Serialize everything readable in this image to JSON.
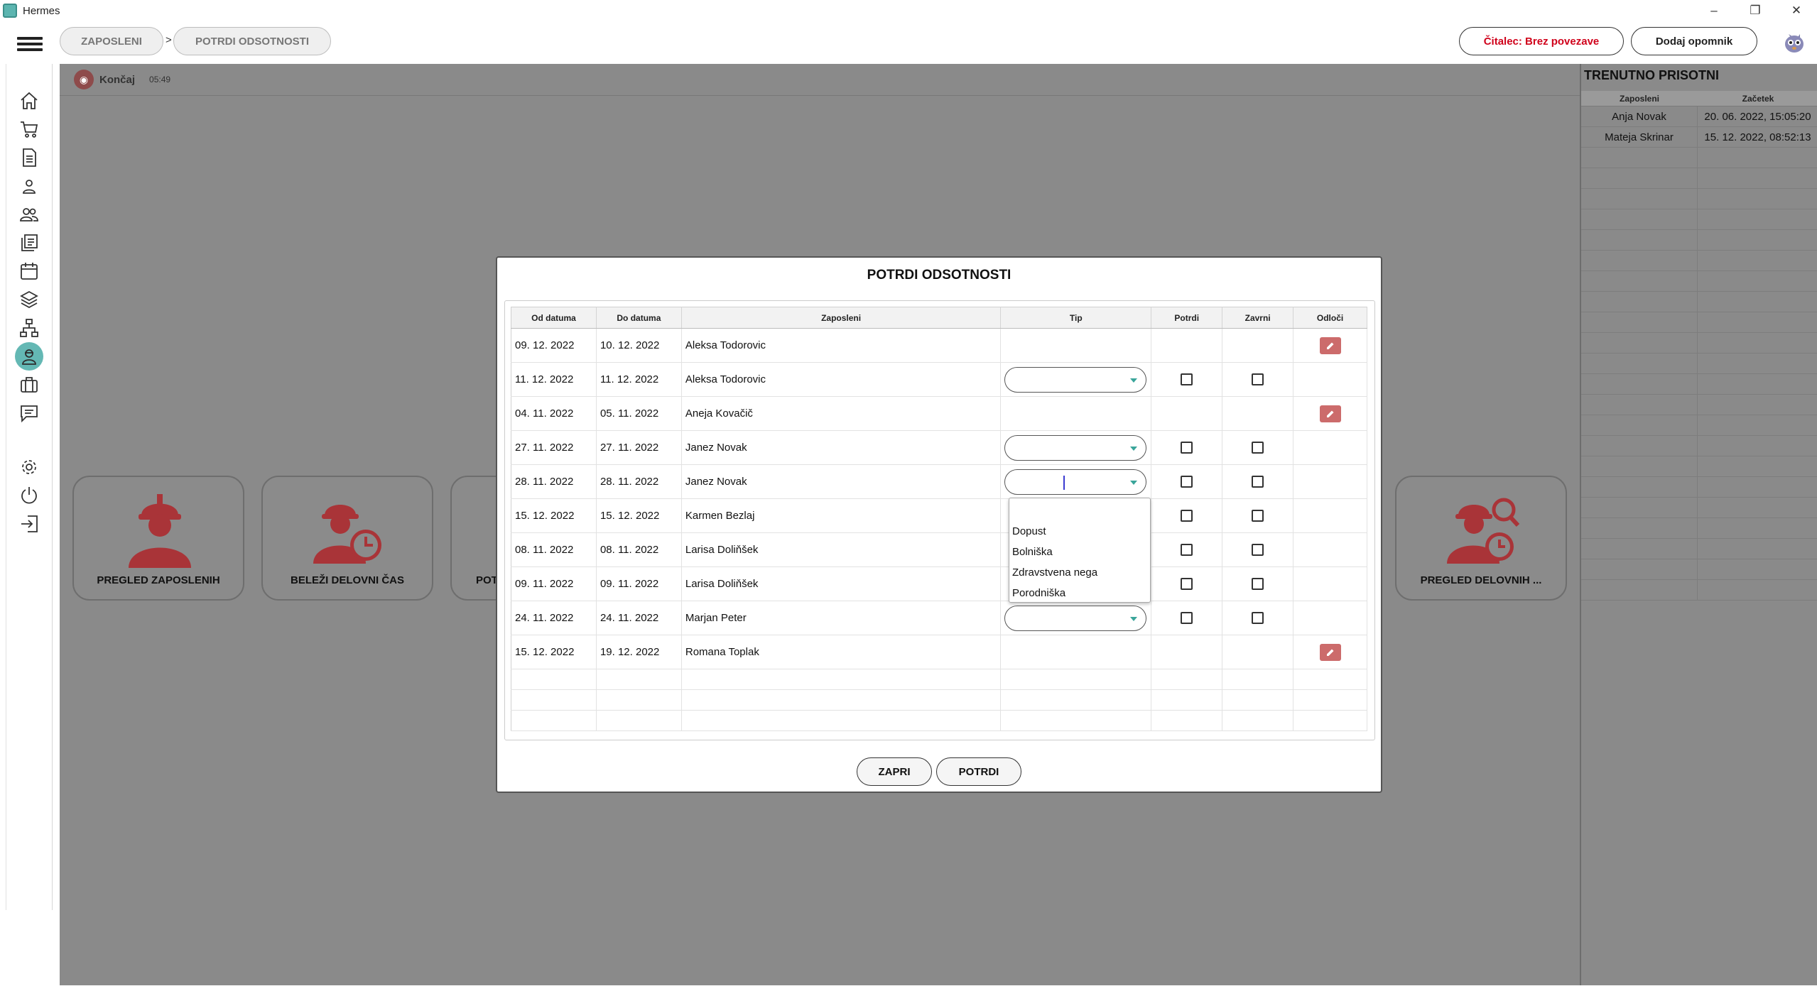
{
  "window": {
    "title": "Hermes",
    "controls": [
      "–",
      "❐",
      "✕"
    ]
  },
  "breadcrumb": {
    "items": [
      "ZAPOSLENI",
      "POTRDI ODSOTNOSTI"
    ],
    "separator": ">"
  },
  "header": {
    "reader_status": "Čitalec: Brez povezave",
    "add_reminder": "Dodaj opomnik"
  },
  "sidebar": {
    "items": [
      "home-icon",
      "cart-icon",
      "document-icon",
      "user-icon",
      "users-icon",
      "documents-icon",
      "calendar-icon",
      "layers-icon",
      "sitemap-icon",
      "employee-icon",
      "briefcase-icon",
      "message-icon",
      "settings-icon",
      "power-icon",
      "logout-icon"
    ],
    "active": "employee-icon"
  },
  "finish": {
    "label": "Končaj",
    "time": "05:49"
  },
  "tiles": [
    "PREGLED ZAPOSLENIH",
    "BELEŽI DELOVNI ČAS",
    "POT",
    "PREGLED DELOVNIH ..."
  ],
  "presence": {
    "title": "TRENUTNO PRISOTNI",
    "columns": [
      "Zaposleni",
      "Začetek"
    ],
    "rows": [
      {
        "name": "Anja Novak",
        "start": "20. 06. 2022, 15:05:20"
      },
      {
        "name": "Mateja Skrinar",
        "start": "15. 12. 2022, 08:52:13"
      }
    ]
  },
  "modal": {
    "title": "POTRDI ODSOTNOSTI",
    "columns": [
      "Od datuma",
      "Do datuma",
      "Zaposleni",
      "Tip",
      "Potrdi",
      "Zavrni",
      "Odloči"
    ],
    "rows": [
      {
        "from": "09. 12. 2022",
        "to": "10. 12. 2022",
        "employee": "Aleksa Todorovic",
        "editable": false
      },
      {
        "from": "11. 12. 2022",
        "to": "11. 12. 2022",
        "employee": "Aleksa Todorovic",
        "editable": true
      },
      {
        "from": "04. 11. 2022",
        "to": "05. 11. 2022",
        "employee": "Aneja  Kovačič",
        "editable": false
      },
      {
        "from": "27. 11. 2022",
        "to": "27. 11. 2022",
        "employee": "Janez Novak",
        "editable": true
      },
      {
        "from": "28. 11. 2022",
        "to": "28. 11. 2022",
        "employee": "Janez Novak",
        "editable": true
      },
      {
        "from": "15. 12. 2022",
        "to": "15. 12. 2022",
        "employee": "Karmen Bezlaj",
        "editable": true
      },
      {
        "from": "08. 11. 2022",
        "to": "08. 11. 2022",
        "employee": "Larisa Doliňšek",
        "editable": true
      },
      {
        "from": "09. 11. 2022",
        "to": "09. 11. 2022",
        "employee": "Larisa Doliňšek",
        "editable": true
      },
      {
        "from": "24. 11. 2022",
        "to": "24. 11. 2022",
        "employee": "Marjan Peter",
        "editable": true
      },
      {
        "from": "15. 12. 2022",
        "to": "19. 12. 2022",
        "employee": "Romana Toplak",
        "editable": false
      }
    ],
    "type_options": [
      "Dopust",
      "Bolniška",
      "Zdravstvena nega",
      "Porodniška"
    ],
    "close_label": "ZAPRI",
    "confirm_label": "POTRDI"
  },
  "colors": {
    "accent": "#5cb5b0",
    "brand_red": "#a93438",
    "reader_red": "#d0021b",
    "overlay": "#8a8a8a"
  }
}
